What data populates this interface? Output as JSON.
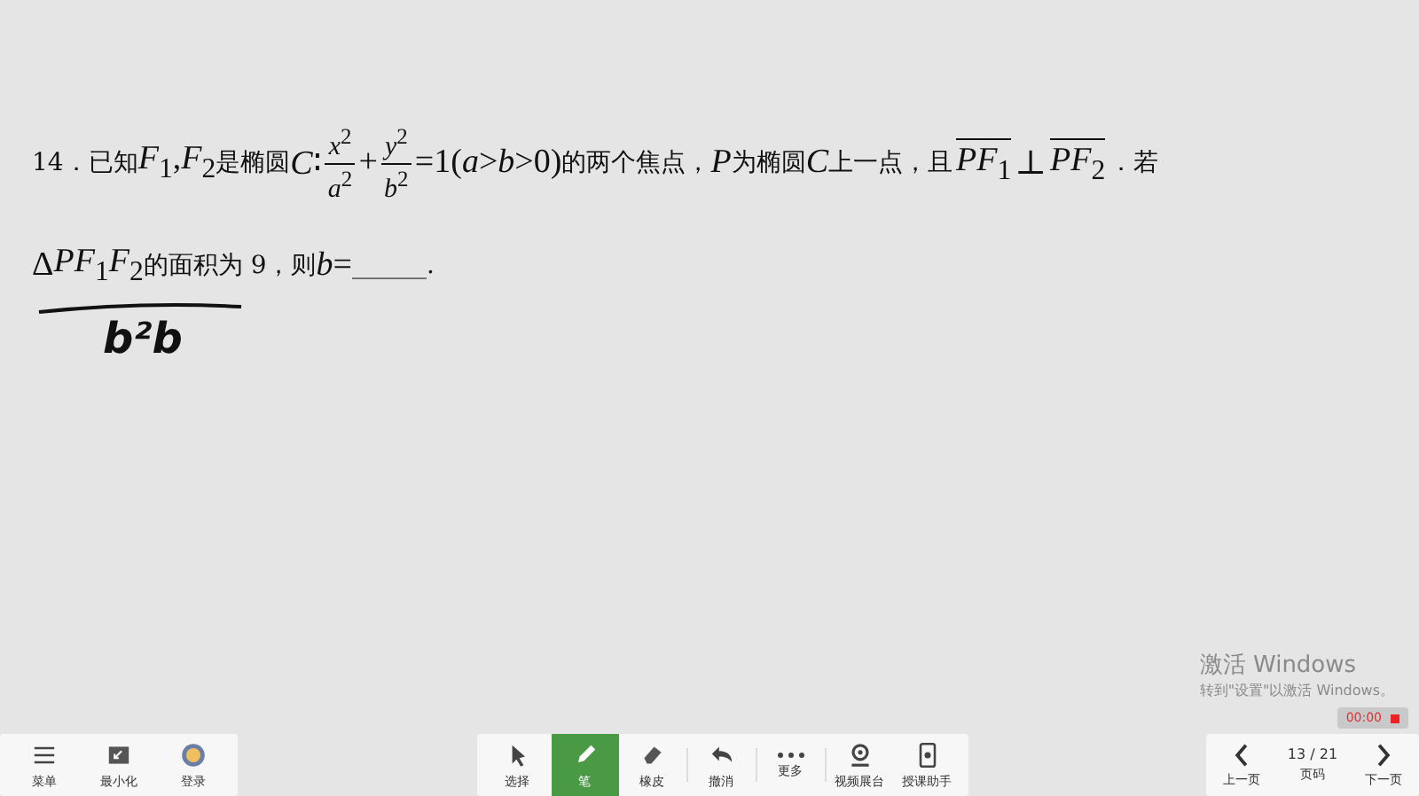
{
  "question": {
    "lines": [
      [
        {
          "kind": "text",
          "s": "14．已知"
        },
        {
          "kind": "math",
          "s": "*F*$_{1}$,*F*$_{2}$"
        },
        {
          "kind": "text",
          "s": "是椭圆"
        },
        {
          "kind": "math",
          "s": "*C*∶"
        },
        {
          "kind": "frac",
          "num": "*x*$^{2}$",
          "den": "*a*$^{2}$"
        },
        {
          "kind": "math",
          "s": "+"
        },
        {
          "kind": "frac",
          "num": "*y*$^{2}$",
          "den": "*b*$^{2}$"
        },
        {
          "kind": "math",
          "s": "=1(*a*>*b*>0)"
        },
        {
          "kind": "text",
          "s": "的两个焦点，"
        },
        {
          "kind": "math",
          "s": "*P*"
        },
        {
          "kind": "text",
          "s": "为椭圆"
        },
        {
          "kind": "math",
          "s": "*C*"
        },
        {
          "kind": "text",
          "s": "上一点，且"
        },
        {
          "kind": "vec",
          "s": "*PF*$_{1}$"
        },
        {
          "kind": "math",
          "s": "⊥"
        },
        {
          "kind": "vec",
          "s": "*PF*$_{2}$"
        },
        {
          "kind": "text",
          "s": "．若"
        }
      ],
      [
        {
          "kind": "math",
          "s": "Δ"
        },
        {
          "kind": "math",
          "s": "*PF*$_{1}$*F*$_{2}$"
        },
        {
          "kind": "text",
          "s": "的面积为 9，则"
        },
        {
          "kind": "math",
          "s": "*b*="
        },
        {
          "kind": "text",
          "s": "______."
        }
      ]
    ]
  },
  "ink_note": "b²b",
  "left_tools": [
    {
      "label": "菜单"
    },
    {
      "label": "最小化"
    },
    {
      "label": "登录"
    }
  ],
  "tools": [
    {
      "label": "选择",
      "selected": false
    },
    {
      "label": "笔",
      "selected": true
    },
    {
      "label": "橡皮",
      "selected": false
    },
    {
      "label": "撤消",
      "selected": false
    },
    {
      "label": "更多",
      "selected": false
    },
    {
      "label": "视频展台",
      "selected": false
    },
    {
      "label": "授课助手",
      "selected": false
    }
  ],
  "pager": {
    "prev": "上一页",
    "page": "13 / 21",
    "page_label": "页码",
    "next": "下一页"
  },
  "recording": {
    "time": "00:00"
  },
  "activation": {
    "title": "激活 Windows",
    "hint": "转到\"设置\"以激活 Windows。"
  }
}
